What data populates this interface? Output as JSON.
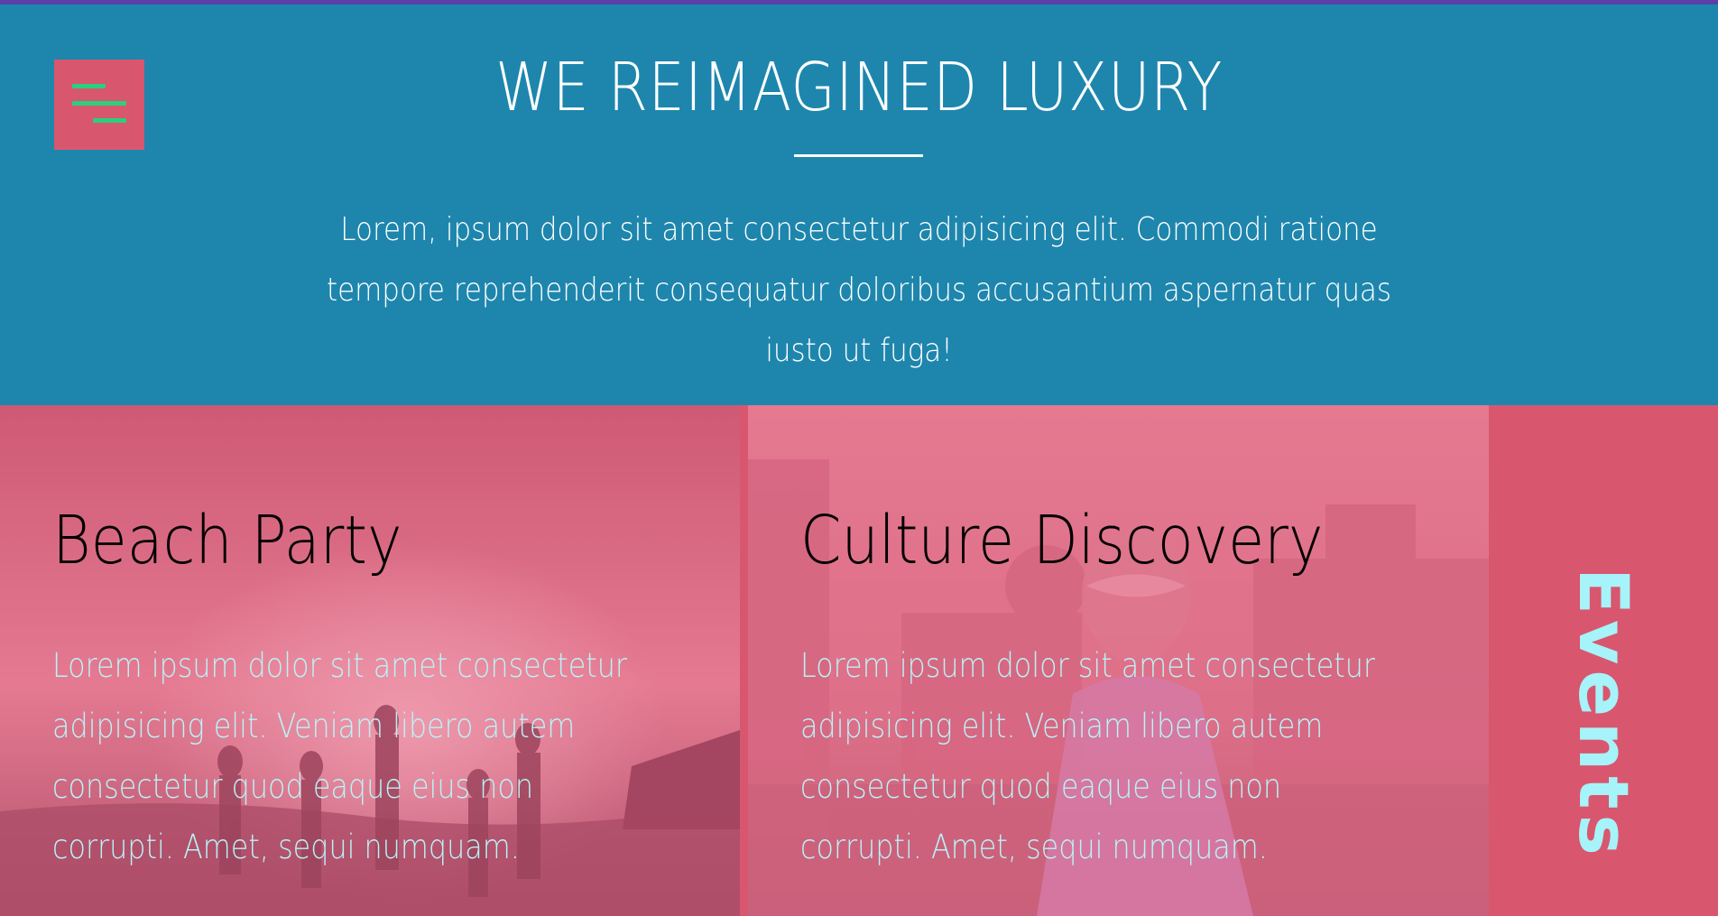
{
  "header": {
    "menu_icon": "hamburger-menu-icon",
    "title": "WE REIMAGINED LUXURY",
    "description": "Lorem, ipsum dolor sit amet consectetur adipisicing elit. Commodi ratione tempore reprehenderit consequatur doloribus accusantium aspernatur quas iusto ut fuga!"
  },
  "cards": [
    {
      "title": "Beach Party",
      "text": "Lorem ipsum dolor sit amet consectetur adipisicing elit. Veniam libero autem consectetur quod eaque eius non corrupti. Amet, sequi numquam."
    },
    {
      "title": "Culture Discovery",
      "text": "Lorem ipsum dolor sit amet consectetur adipisicing elit. Veniam libero autem consectetur quod eaque eius non corrupti. Amet, sequi numquam."
    }
  ],
  "side_tab": {
    "label": "Events"
  },
  "colors": {
    "hero_bg": "#1e86ad",
    "accent_pink": "#d9566f",
    "menu_lines": "#2ad07b",
    "card_text": "#b9f3f7",
    "side_label": "#a6f3f9",
    "top_strip": "#5a3fa8"
  }
}
